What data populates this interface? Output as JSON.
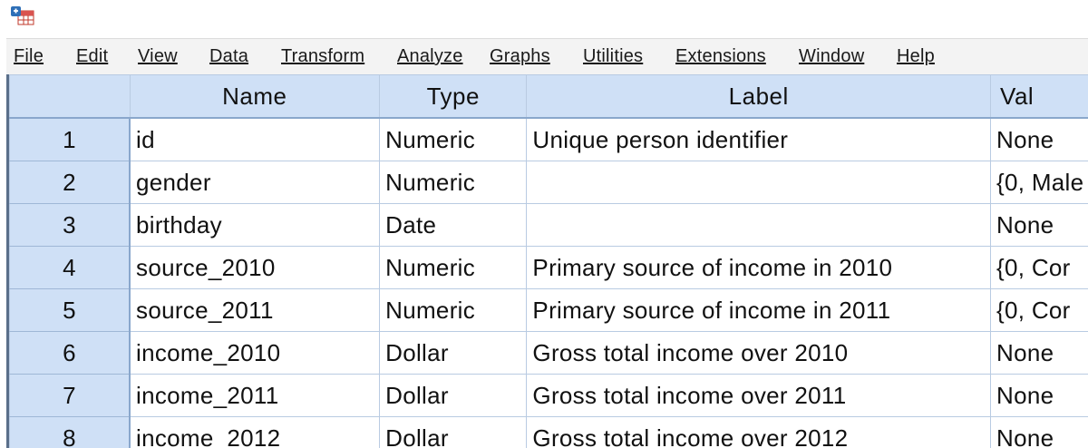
{
  "menu": {
    "items": [
      {
        "label": "File"
      },
      {
        "label": "Edit"
      },
      {
        "label": "View"
      },
      {
        "label": "Data"
      },
      {
        "label": "Transform"
      },
      {
        "label": "Analyze"
      },
      {
        "label": "Graphs"
      },
      {
        "label": "Utilities"
      },
      {
        "label": "Extensions"
      },
      {
        "label": "Window"
      },
      {
        "label": "Help"
      }
    ]
  },
  "grid": {
    "columns": {
      "name": "Name",
      "type": "Type",
      "label": "Label",
      "values": "Val"
    },
    "rows": [
      {
        "num": "1",
        "name": "id",
        "type": "Numeric",
        "label": "Unique person identifier",
        "values": "None"
      },
      {
        "num": "2",
        "name": "gender",
        "type": "Numeric",
        "label": "",
        "values": "{0, Male"
      },
      {
        "num": "3",
        "name": "birthday",
        "type": "Date",
        "label": "",
        "values": "None"
      },
      {
        "num": "4",
        "name": "source_2010",
        "type": "Numeric",
        "label": "Primary source of income in 2010",
        "values": "{0, Cor"
      },
      {
        "num": "5",
        "name": "source_2011",
        "type": "Numeric",
        "label": "Primary source of income in 2011",
        "values": "{0, Cor"
      },
      {
        "num": "6",
        "name": "income_2010",
        "type": "Dollar",
        "label": "Gross total income over 2010",
        "values": "None"
      },
      {
        "num": "7",
        "name": "income_2011",
        "type": "Dollar",
        "label": "Gross total income over 2011",
        "values": "None"
      },
      {
        "num": "8",
        "name": "income_2012",
        "type": "Dollar",
        "label": "Gross total income over 2012",
        "values": "None"
      }
    ]
  }
}
